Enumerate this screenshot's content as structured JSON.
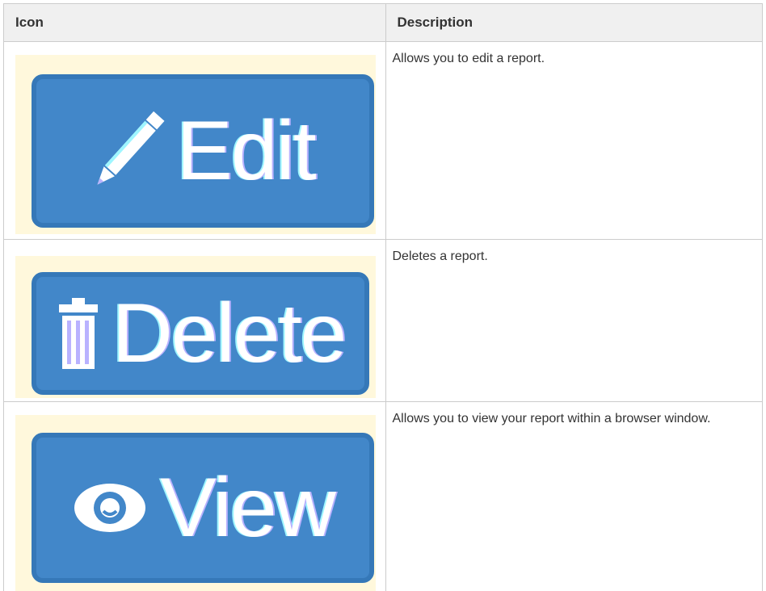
{
  "table": {
    "headers": {
      "icon": "Icon",
      "description": "Description"
    },
    "rows": [
      {
        "button_label": "Edit",
        "icon": "pencil-icon",
        "description": "Allows you to edit a report."
      },
      {
        "button_label": "Delete",
        "icon": "trash-icon",
        "description": "Deletes a report."
      },
      {
        "button_label": "View",
        "icon": "eye-icon",
        "description": "Allows you to view your report within a browser window."
      }
    ]
  },
  "colors": {
    "button_fill": "#4287c9",
    "button_border": "#3578b8",
    "highlight": "#fff8dc",
    "header_bg": "#f0f0f0",
    "grid": "#cccccc",
    "text": "#333333"
  }
}
